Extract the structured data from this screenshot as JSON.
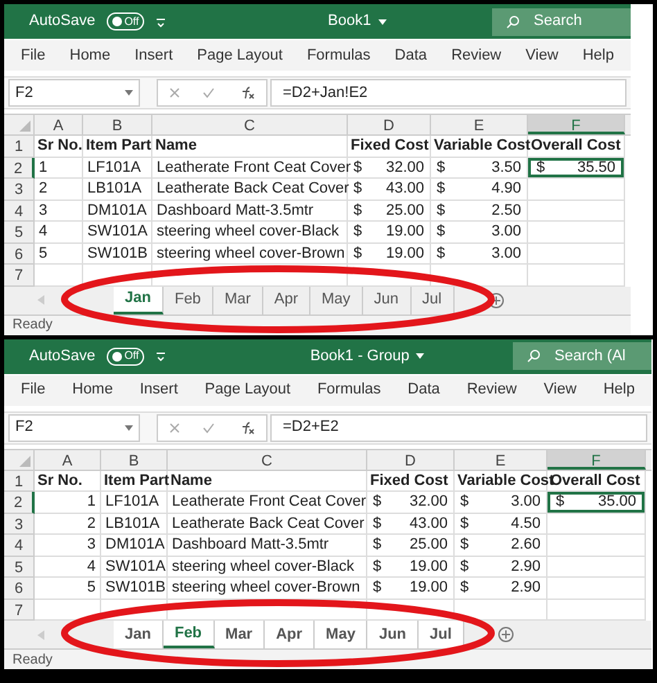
{
  "panels": [
    {
      "autosave": {
        "label": "AutoSave",
        "toggle": "Off",
        "on": false
      },
      "title": "Book1",
      "search": "Search",
      "ribbon": [
        "File",
        "Home",
        "Insert",
        "Page Layout",
        "Formulas",
        "Data",
        "Review",
        "View",
        "Help"
      ],
      "name_box": "F2",
      "formula": "=D2+Jan!E2",
      "kind": "text",
      "columns": [
        {
          "label": "A",
          "selected": false
        },
        {
          "label": "B",
          "selected": false
        },
        {
          "label": "C",
          "selected": false
        },
        {
          "label": "D",
          "selected": false
        },
        {
          "label": "E",
          "selected": false
        },
        {
          "label": "F",
          "selected": true
        }
      ],
      "header": {
        "row": "1",
        "cells": [
          "Sr No.",
          "Item Part",
          "Name",
          "Fixed Cost",
          "Variable Cost",
          "Overall Cost"
        ]
      },
      "rows": [
        {
          "row": "2",
          "sr": "1",
          "part": "LF101A",
          "name": "Leatherate Front Ceat Cover",
          "fixed": {
            "currency": "$",
            "amount": "32.00"
          },
          "variable": {
            "currency": "$",
            "amount": "3.50"
          },
          "overall": {
            "currency": "$",
            "amount": "35.50",
            "selected": true
          }
        },
        {
          "row": "3",
          "sr": "2",
          "part": "LB101A",
          "name": "Leatherate Back Ceat Cover",
          "fixed": {
            "currency": "$",
            "amount": "43.00"
          },
          "variable": {
            "currency": "$",
            "amount": "4.90"
          }
        },
        {
          "row": "4",
          "sr": "3",
          "part": "DM101A",
          "name": "Dashboard Matt-3.5mtr",
          "fixed": {
            "currency": "$",
            "amount": "25.00"
          },
          "variable": {
            "currency": "$",
            "amount": "2.50"
          }
        },
        {
          "row": "5",
          "sr": "4",
          "part": "SW101A",
          "name": "steering wheel cover-Black",
          "fixed": {
            "currency": "$",
            "amount": "19.00"
          },
          "variable": {
            "currency": "$",
            "amount": "3.00"
          }
        },
        {
          "row": "6",
          "sr": "5",
          "part": "SW101B",
          "name": "steering wheel cover-Brown",
          "fixed": {
            "currency": "$",
            "amount": "19.00"
          },
          "variable": {
            "currency": "$",
            "amount": "3.00"
          }
        },
        {
          "row": "7"
        }
      ],
      "sheets": [
        {
          "label": "Jan",
          "selected": true,
          "grouped": true
        },
        {
          "label": "Feb",
          "selected": false,
          "grouped": false
        },
        {
          "label": "Mar",
          "selected": false,
          "grouped": false
        },
        {
          "label": "Apr",
          "selected": false,
          "grouped": false
        },
        {
          "label": "May",
          "selected": false,
          "grouped": false
        },
        {
          "label": "Jun",
          "selected": false,
          "grouped": false
        },
        {
          "label": "Jul",
          "selected": false,
          "grouped": false
        }
      ],
      "status": "Ready"
    },
    {
      "autosave": {
        "label": "AutoSave",
        "toggle": "Off",
        "on": false
      },
      "title": "Book1 - Group",
      "search": "Search (Al",
      "ribbon": [
        "File",
        "Home",
        "Insert",
        "Page Layout",
        "Formulas",
        "Data",
        "Review",
        "View",
        "Help"
      ],
      "name_box": "F2",
      "formula": "=D2+E2",
      "kind": "numeric",
      "columns": [
        {
          "label": "A",
          "selected": false
        },
        {
          "label": "B",
          "selected": false
        },
        {
          "label": "C",
          "selected": false
        },
        {
          "label": "D",
          "selected": false
        },
        {
          "label": "E",
          "selected": false
        },
        {
          "label": "F",
          "selected": true
        }
      ],
      "header": {
        "row": "1",
        "cells": [
          "Sr No.",
          "Item Part",
          "Name",
          "Fixed Cost",
          "Variable Cost",
          "Overall Cost"
        ]
      },
      "rows": [
        {
          "row": "2",
          "sr": "1",
          "part": "LF101A",
          "name": "Leatherate Front Ceat Cover",
          "fixed": {
            "currency": "$",
            "amount": "32.00"
          },
          "variable": {
            "currency": "$",
            "amount": "3.00"
          },
          "overall": {
            "currency": "$",
            "amount": "35.00",
            "selected": true
          }
        },
        {
          "row": "3",
          "sr": "2",
          "part": "LB101A",
          "name": "Leatherate Back Ceat Cover",
          "fixed": {
            "currency": "$",
            "amount": "43.00"
          },
          "variable": {
            "currency": "$",
            "amount": "4.50"
          }
        },
        {
          "row": "4",
          "sr": "3",
          "part": "DM101A",
          "name": "Dashboard Matt-3.5mtr",
          "fixed": {
            "currency": "$",
            "amount": "25.00"
          },
          "variable": {
            "currency": "$",
            "amount": "2.60"
          }
        },
        {
          "row": "5",
          "sr": "4",
          "part": "SW101A",
          "name": "steering wheel cover-Black",
          "fixed": {
            "currency": "$",
            "amount": "19.00"
          },
          "variable": {
            "currency": "$",
            "amount": "2.90"
          }
        },
        {
          "row": "6",
          "sr": "5",
          "part": "SW101B",
          "name": "steering wheel cover-Brown",
          "fixed": {
            "currency": "$",
            "amount": "19.00"
          },
          "variable": {
            "currency": "$",
            "amount": "2.90"
          }
        },
        {
          "row": "7"
        }
      ],
      "sheets": [
        {
          "label": "Jan",
          "selected": false,
          "grouped": true
        },
        {
          "label": "Feb",
          "selected": true,
          "grouped": true
        },
        {
          "label": "Mar",
          "selected": false,
          "grouped": true
        },
        {
          "label": "Apr",
          "selected": false,
          "grouped": true
        },
        {
          "label": "May",
          "selected": false,
          "grouped": true
        },
        {
          "label": "Jun",
          "selected": false,
          "grouped": true
        },
        {
          "label": "Jul",
          "selected": false,
          "grouped": true
        }
      ],
      "status": "Ready"
    }
  ]
}
